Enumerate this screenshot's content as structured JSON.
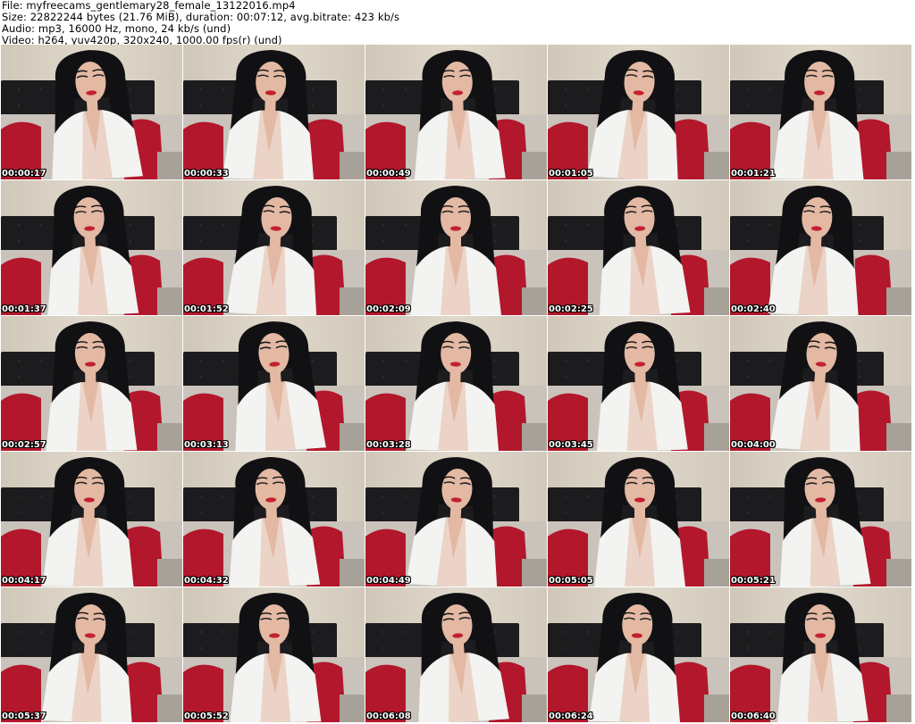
{
  "header": {
    "file_line": "File: myfreecams_gentlemary28_female_13122016.mp4",
    "size_line": "Size: 22822244 bytes (21.76 MiB), duration: 00:07:12, avg.bitrate: 423 kb/s",
    "audio_line": "Audio: mp3, 16000 Hz, mono, 24 kb/s (und)",
    "video_line": "Video: h264, yuv420p, 320x240, 1000.00 fps(r) (und)"
  },
  "thumbnails": [
    {
      "timestamp": "00:00:17"
    },
    {
      "timestamp": "00:00:33"
    },
    {
      "timestamp": "00:00:49"
    },
    {
      "timestamp": "00:01:05"
    },
    {
      "timestamp": "00:01:21"
    },
    {
      "timestamp": "00:01:37"
    },
    {
      "timestamp": "00:01:52"
    },
    {
      "timestamp": "00:02:09"
    },
    {
      "timestamp": "00:02:25"
    },
    {
      "timestamp": "00:02:40"
    },
    {
      "timestamp": "00:02:57"
    },
    {
      "timestamp": "00:03:13"
    },
    {
      "timestamp": "00:03:28"
    },
    {
      "timestamp": "00:03:45"
    },
    {
      "timestamp": "00:04:00"
    },
    {
      "timestamp": "00:04:17"
    },
    {
      "timestamp": "00:04:32"
    },
    {
      "timestamp": "00:04:49"
    },
    {
      "timestamp": "00:05:05"
    },
    {
      "timestamp": "00:05:21"
    },
    {
      "timestamp": "00:05:37"
    },
    {
      "timestamp": "00:05:52"
    },
    {
      "timestamp": "00:06:08"
    },
    {
      "timestamp": "00:06:24"
    },
    {
      "timestamp": "00:06:40"
    }
  ],
  "colors": {
    "wall": "#d8d0c2",
    "headboard": "#1c1c1e",
    "pillow_red": "#b3172b",
    "fur_throw": "#c9c3bb",
    "robe_white": "#f3f3f1",
    "skin": "#e3b9a4",
    "hair": "#111114",
    "lips": "#c4202f"
  }
}
